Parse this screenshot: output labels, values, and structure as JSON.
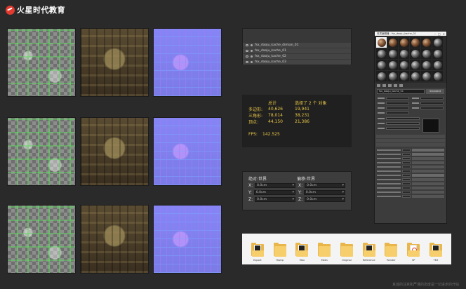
{
  "brand": {
    "name": "火星时代教育"
  },
  "layers": {
    "items": [
      "fsx_daoju_kache_dimian_01",
      "fsx_daoju_kache_01",
      "fsx_daoju_kache_02",
      "fsx_daoju_kache_03"
    ]
  },
  "stats": {
    "header_total": "总计",
    "header_selected": "选择了 2 个 对象",
    "rows": [
      {
        "label": "多边形:",
        "total": "40,626",
        "selected": "19,941"
      },
      {
        "label": "三角形:",
        "total": "78,014",
        "selected": "38,231"
      },
      {
        "label": "顶点:",
        "total": "44,150",
        "selected": "21,386"
      }
    ],
    "fps_label": "FPS:",
    "fps_value": "142.525"
  },
  "transform": {
    "absolute_label": "绝对:世界",
    "offset_label": "偏移:世界",
    "rows": [
      {
        "axis": "X:",
        "abs": "0.0cm",
        "off": "0.0cm"
      },
      {
        "axis": "Y:",
        "abs": "0.0cm",
        "off": "0.0cm"
      },
      {
        "axis": "Z:",
        "abs": "0.0cm",
        "off": "0.0cm"
      }
    ]
  },
  "folders": {
    "items": [
      {
        "name": "Export",
        "type": "doc-dark"
      },
      {
        "name": "HipUp",
        "type": "plain"
      },
      {
        "name": "Max",
        "type": "doc-dark"
      },
      {
        "name": "Mesh",
        "type": "plain"
      },
      {
        "name": "Original",
        "type": "plain"
      },
      {
        "name": "Reference",
        "type": "doc-dark"
      },
      {
        "name": "Render",
        "type": "plain"
      },
      {
        "name": "SP",
        "type": "doc-red"
      },
      {
        "name": "TEX",
        "type": "doc-dark"
      }
    ]
  },
  "material_editor": {
    "title": "材质编辑器 - fsx_daoju_kache_01",
    "material_name": "fsx_daoju_kache_01",
    "material_type": "Standard"
  },
  "watermark": "真诚的注意和严谨的态度是一切进步的开始"
}
